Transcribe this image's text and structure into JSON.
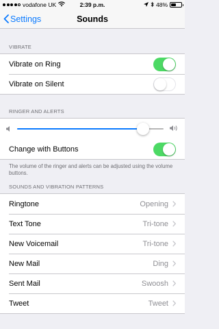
{
  "status_bar": {
    "carrier": "vodafone UK",
    "time": "2:39 p.m.",
    "battery_text": "48%",
    "battery_level": 0.48,
    "signal_bars": 4,
    "signal_total": 5
  },
  "nav": {
    "back_label": "Settings",
    "title": "Sounds"
  },
  "vibrate": {
    "header": "VIBRATE",
    "rows": [
      {
        "label": "Vibrate on Ring",
        "on": true
      },
      {
        "label": "Vibrate on Silent",
        "on": false
      }
    ]
  },
  "ringer": {
    "header": "RINGER AND ALERTS",
    "volume_level": 0.86,
    "change_with_buttons_label": "Change with Buttons",
    "change_with_buttons_on": true,
    "footer": "The volume of the ringer and alerts can be adjusted using the volume buttons."
  },
  "patterns": {
    "header": "SOUNDS AND VIBRATION PATTERNS",
    "rows": [
      {
        "label": "Ringtone",
        "value": "Opening"
      },
      {
        "label": "Text Tone",
        "value": "Tri-tone"
      },
      {
        "label": "New Voicemail",
        "value": "Tri-tone"
      },
      {
        "label": "New Mail",
        "value": "Ding"
      },
      {
        "label": "Sent Mail",
        "value": "Swoosh"
      },
      {
        "label": "Tweet",
        "value": "Tweet"
      }
    ]
  },
  "colors": {
    "accent": "#0a7aff",
    "toggle_on": "#4cd964"
  }
}
